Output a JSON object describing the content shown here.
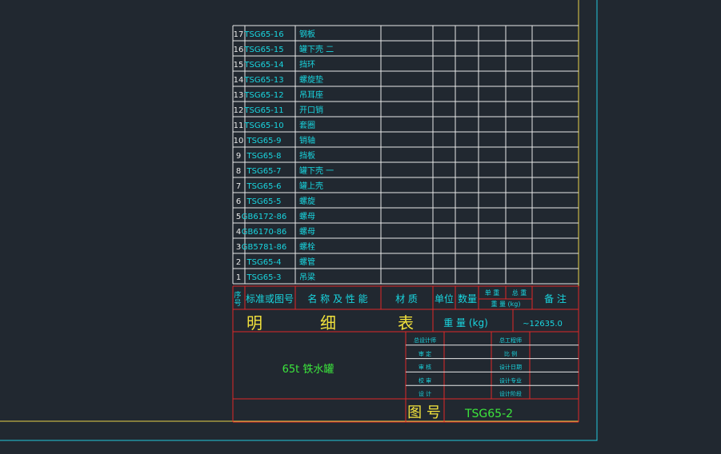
{
  "colors": {
    "background": "#212830",
    "outer_frame": "#22c8dc",
    "inner_frame": "#e6d24a",
    "grid_line": "#e8e8e8",
    "red_line": "#e02828",
    "cyan_text": "#19d6e0",
    "yellow_text": "#f2e23c",
    "green_text": "#3ce63c",
    "white_text": "#e8e8e8"
  },
  "parts_list": {
    "rows": [
      {
        "no": "17",
        "code": "TSG65-16",
        "name": "钢板"
      },
      {
        "no": "16",
        "code": "TSG65-15",
        "name": "罐下壳  二"
      },
      {
        "no": "15",
        "code": "TSG65-14",
        "name": "挡环"
      },
      {
        "no": "14",
        "code": "TSG65-13",
        "name": "螺旋垫"
      },
      {
        "no": "13",
        "code": "TSG65-12",
        "name": "吊耳座"
      },
      {
        "no": "12",
        "code": "TSG65-11",
        "name": "开口销"
      },
      {
        "no": "11",
        "code": "TSG65-10",
        "name": "套圈"
      },
      {
        "no": "10",
        "code": "TSG65-9",
        "name": "销轴"
      },
      {
        "no": "9",
        "code": "TSG65-8",
        "name": "挡板"
      },
      {
        "no": "8",
        "code": "TSG65-7",
        "name": "罐下壳  一"
      },
      {
        "no": "7",
        "code": "TSG65-6",
        "name": "罐上壳"
      },
      {
        "no": "6",
        "code": "TSG65-5",
        "name": "螺旋"
      },
      {
        "no": "5",
        "code": "GB6172-86",
        "name": "螺母"
      },
      {
        "no": "4",
        "code": "GB6170-86",
        "name": "螺母"
      },
      {
        "no": "3",
        "code": "GB5781-86",
        "name": "螺栓"
      },
      {
        "no": "2",
        "code": "TSG65-4",
        "name": "螺管"
      },
      {
        "no": "1",
        "code": "TSG65-3",
        "name": "吊梁"
      }
    ],
    "header": {
      "seq": "序号",
      "code": "标准或图号",
      "name": "名 称 及 性 能",
      "material": "材    质",
      "unit": "单位",
      "qty": "数量",
      "single": "单 重",
      "total": "总 重",
      "weight": "重 量 (kg)",
      "remark": "备  注"
    }
  },
  "title_block": {
    "detail_title": [
      "明",
      "细",
      "表"
    ],
    "weight_label": "重  量  (kg)",
    "weight_value": "~12635.0",
    "product_name": "65t 铁水罐",
    "left_roles": [
      "总设计师",
      "审  定",
      "审  核",
      "校  审",
      "设  计"
    ],
    "right_roles": [
      "总工程师",
      "比  例",
      "设计日期",
      "设计专业",
      "设计阶段"
    ],
    "drawing_no_label": "图  号",
    "drawing_no": "TSG65-2"
  }
}
